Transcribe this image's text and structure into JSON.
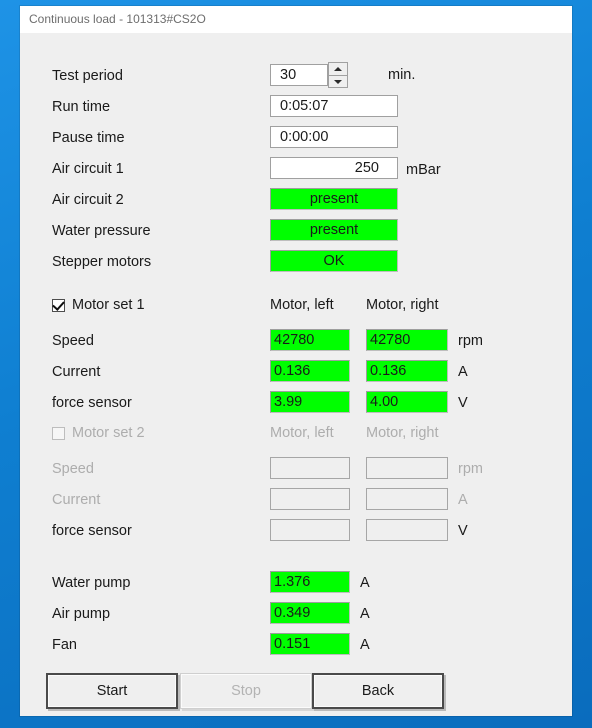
{
  "window": {
    "title": "Continuous load - 101313#CS2O"
  },
  "colors": {
    "status_ok": "#00FF00",
    "desktop": "#0F7FD1",
    "titlebar": "#FFFFFF",
    "client": "#EFEFEF"
  },
  "form": {
    "test_period": {
      "label": "Test period",
      "value": "30",
      "unit": "min."
    },
    "run_time": {
      "label": "Run time",
      "value": "0:05:07",
      "unit": ""
    },
    "pause_time": {
      "label": "Pause time",
      "value": "0:00:00",
      "unit": ""
    },
    "air_circuit_1": {
      "label": "Air circuit 1",
      "value": "250",
      "unit": "mBar"
    },
    "air_circuit_2": {
      "label": "Air circuit 2",
      "value": "present",
      "unit": ""
    },
    "water_pressure": {
      "label": "Water pressure",
      "value": "present",
      "unit": ""
    },
    "stepper_motors": {
      "label": "Stepper motors",
      "value": "OK",
      "unit": ""
    }
  },
  "motor_set_1": {
    "checkbox_label": "Motor set 1",
    "checked": true,
    "col_left_header": "Motor, left",
    "col_right_header": "Motor, right",
    "rows": [
      {
        "label": "Speed",
        "left": "42780",
        "right": "42780",
        "unit": "rpm"
      },
      {
        "label": "Current",
        "left": "0.136",
        "right": "0.136",
        "unit": "A"
      },
      {
        "label": "force sensor",
        "left": "3.99",
        "right": "4.00",
        "unit": "V"
      }
    ]
  },
  "motor_set_2": {
    "checkbox_label": "Motor set 2",
    "checked": false,
    "col_left_header": "Motor, left",
    "col_right_header": "Motor, right",
    "rows": [
      {
        "label": "Speed",
        "left": "",
        "right": "",
        "unit": "rpm"
      },
      {
        "label": "Current",
        "left": "",
        "right": "",
        "unit": "A"
      },
      {
        "label": "force sensor",
        "left": "",
        "right": "",
        "unit": "V"
      }
    ]
  },
  "aux": [
    {
      "label": "Water pump",
      "value": "1.376",
      "unit": "A"
    },
    {
      "label": "Air pump",
      "value": "0.349",
      "unit": "A"
    },
    {
      "label": "Fan",
      "value": "0.151",
      "unit": "A"
    }
  ],
  "buttons": {
    "start": "Start",
    "stop": "Stop",
    "back": "Back"
  }
}
